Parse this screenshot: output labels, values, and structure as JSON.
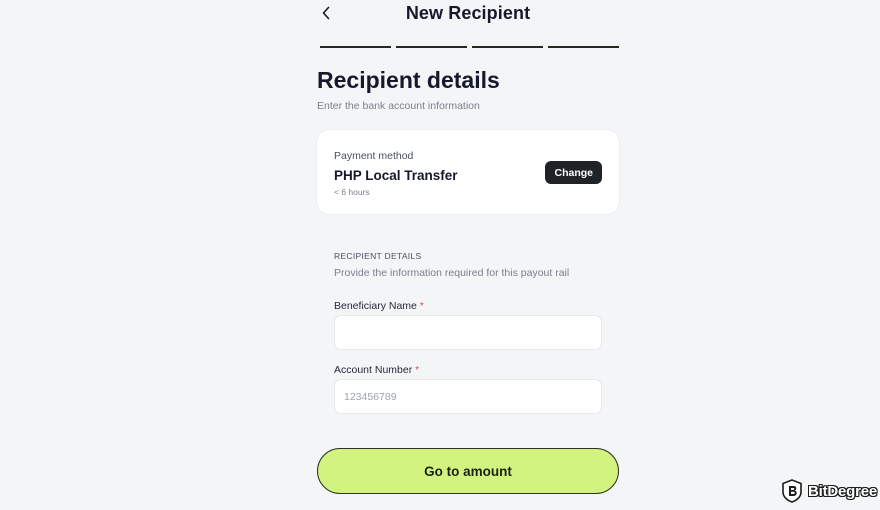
{
  "header": {
    "title": "New Recipient",
    "back_icon": "chevron-left-icon"
  },
  "progress": {
    "total_steps": 4
  },
  "section": {
    "title": "Recipient details",
    "subtitle": "Enter the bank account information"
  },
  "payment_method": {
    "label": "Payment method",
    "name": "PHP Local Transfer",
    "time": "< 6 hours",
    "change_label": "Change"
  },
  "recipient_details": {
    "heading": "RECIPIENT DETAILS",
    "subheading": "Provide the information required for this payout rail"
  },
  "fields": {
    "beneficiary_name": {
      "label": "Beneficiary Name",
      "required_mark": "*",
      "value": "",
      "placeholder": ""
    },
    "account_number": {
      "label": "Account Number",
      "required_mark": "*",
      "value": "",
      "placeholder": "123456789"
    }
  },
  "cta": {
    "label": "Go to amount"
  },
  "watermark": {
    "text": "BitDegree",
    "icon": "bitdegree-logo-icon"
  },
  "colors": {
    "background": "#f4f5f7",
    "accent": "#d2f37f",
    "required": "#e0475a",
    "dark_button": "#1f2326"
  }
}
